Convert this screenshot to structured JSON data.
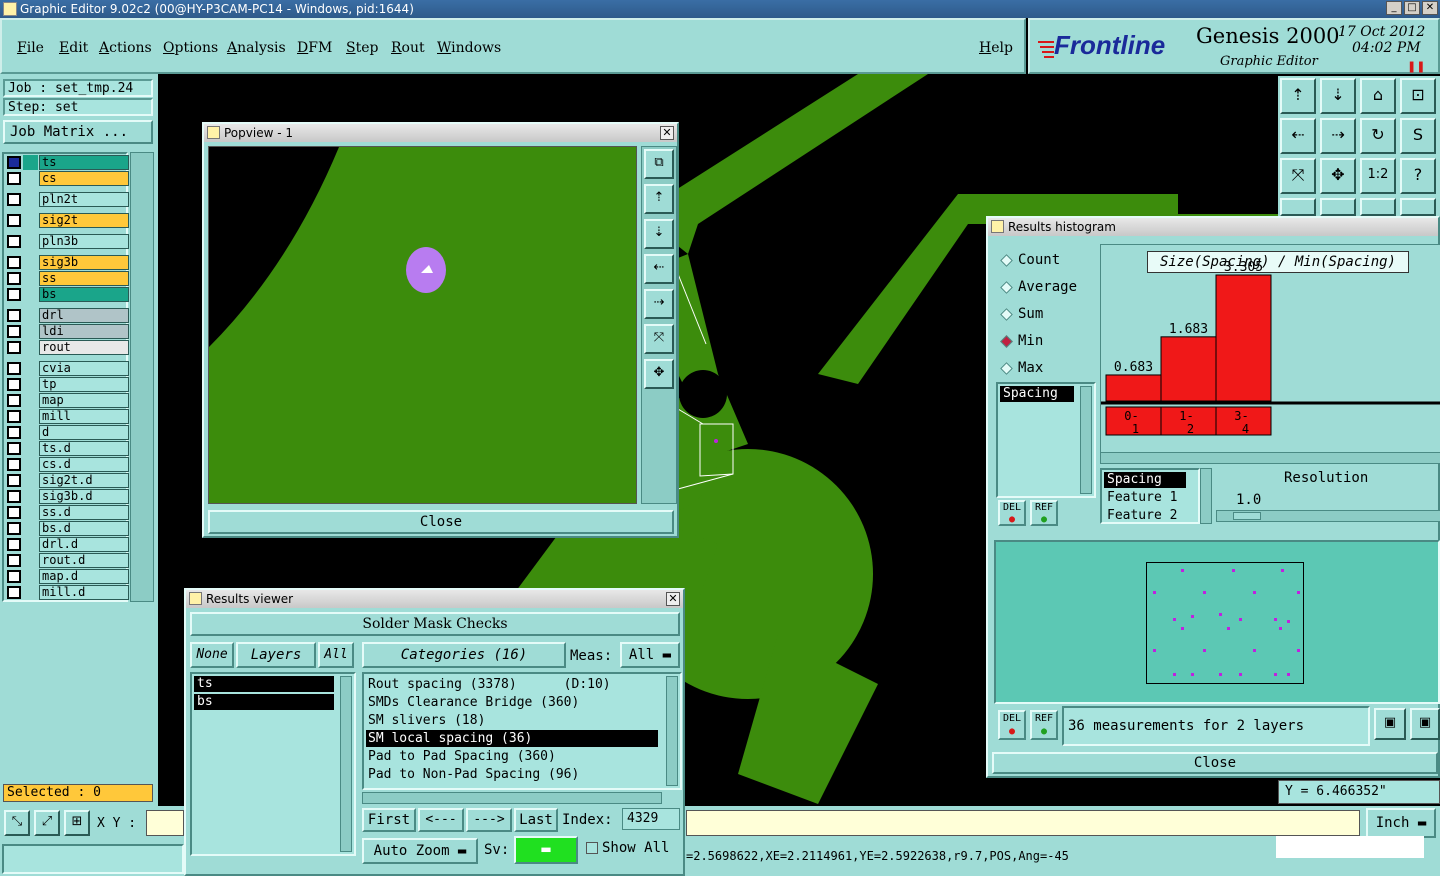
{
  "window": {
    "title": "Graphic Editor 9.02c2 (00@HY-P3CAM-PC14 - Windows, pid:1644)"
  },
  "menu": {
    "items": [
      "File",
      "Edit",
      "Actions",
      "Options",
      "Analysis",
      "DFM",
      "Step",
      "Rout",
      "Windows"
    ],
    "help": "Help"
  },
  "brand": {
    "logo": "Frontline",
    "product": "Genesis 2000",
    "subtitle": "Graphic Editor",
    "date": "17 Oct 2012",
    "time": "04:02 PM"
  },
  "job": {
    "job_label": "Job : set_tmp.24",
    "step_label": "Step: set",
    "matrix_button": "Job Matrix ..."
  },
  "layers": [
    {
      "name": "ts",
      "color": "#1aa58a"
    },
    {
      "name": "cs",
      "color": "#ffc83a"
    },
    {
      "name": "pln2t",
      "color": "#a8e4de"
    },
    {
      "name": "sig2t",
      "color": "#ffc83a"
    },
    {
      "name": "pln3b",
      "color": "#a8e4de"
    },
    {
      "name": "sig3b",
      "color": "#ffc83a"
    },
    {
      "name": "ss",
      "color": "#ffc83a"
    },
    {
      "name": "bs",
      "color": "#1aa58a"
    },
    {
      "name": "drl",
      "color": "#b0c4c8"
    },
    {
      "name": "ldi",
      "color": "#b0c4c8"
    },
    {
      "name": "rout",
      "color": "#e8e8e8"
    },
    {
      "name": "cvia",
      "color": "#a8e4de"
    },
    {
      "name": "tp",
      "color": "#a8e4de"
    },
    {
      "name": "map",
      "color": "#a8e4de"
    },
    {
      "name": "mill",
      "color": "#a8e4de"
    },
    {
      "name": "d",
      "color": "#a8e4de"
    },
    {
      "name": "ts.d",
      "color": "#a8e4de"
    },
    {
      "name": "cs.d",
      "color": "#a8e4de"
    },
    {
      "name": "sig2t.d",
      "color": "#a8e4de"
    },
    {
      "name": "sig3b.d",
      "color": "#a8e4de"
    },
    {
      "name": "ss.d",
      "color": "#a8e4de"
    },
    {
      "name": "bs.d",
      "color": "#a8e4de"
    },
    {
      "name": "drl.d",
      "color": "#a8e4de"
    },
    {
      "name": "rout.d",
      "color": "#a8e4de"
    },
    {
      "name": "map.d",
      "color": "#a8e4de"
    },
    {
      "name": "mill.d",
      "color": "#a8e4de"
    }
  ],
  "selected": "Selected : 0",
  "bottom": {
    "xy_label": "X Y :",
    "units": "Inch",
    "coords": "=2.5698622,XE=2.2114961,YE=2.5922638,r9.7,POS,Ang=-45",
    "y_readout": "Y = 6.466352\""
  },
  "popview": {
    "title": "Popview - 1",
    "close": "Close"
  },
  "results_viewer": {
    "title": "Results viewer",
    "header": "Solder Mask Checks",
    "none": "None",
    "layers": "Layers",
    "all": "All",
    "layer_list": [
      "ts",
      "bs"
    ],
    "categories_label": "Categories (16)",
    "meas_label": "Meas:",
    "meas_value": "All",
    "categories": [
      "Rout spacing (3378)      (D:10)",
      "SMDs Clearance Bridge (360)",
      "SM slivers (18)",
      "SM local spacing (36)",
      "Pad to Pad Spacing (360)",
      "Pad to Non-Pad Spacing (96)"
    ],
    "selected_index": 3,
    "first": "First",
    "prev": "<---",
    "next": "--->",
    "last": "Last",
    "index_label": "Index:",
    "index_value": "4329",
    "auto_zoom": "Auto Zoom",
    "sv": "Sv:",
    "show_all": "Show All"
  },
  "histogram": {
    "title": "Results histogram",
    "modes": [
      "Count",
      "Average",
      "Sum",
      "Min",
      "Max"
    ],
    "selected_mode": "Min",
    "list_item": "Spacing",
    "chart_title": "Size(Spacing) / Min(Spacing)",
    "del": "DEL",
    "ref": "REF",
    "resolution_list": [
      "Spacing",
      "Feature 1",
      "Feature 2"
    ],
    "resolution_label": "Resolution",
    "resolution_value": "1.0",
    "summary": "36 measurements for 2 layers",
    "close": "Close"
  },
  "chart_data": {
    "type": "bar",
    "title": "Size(Spacing) / Min(Spacing)",
    "categories": [
      "0-1",
      "1-2",
      "3-4"
    ],
    "values": [
      0.683,
      1.683,
      3.305
    ]
  },
  "colors": {
    "panel": "#9fdcd6",
    "copper": "#3c8c0c",
    "bar": "#f01818",
    "accent": "#c020e0"
  }
}
